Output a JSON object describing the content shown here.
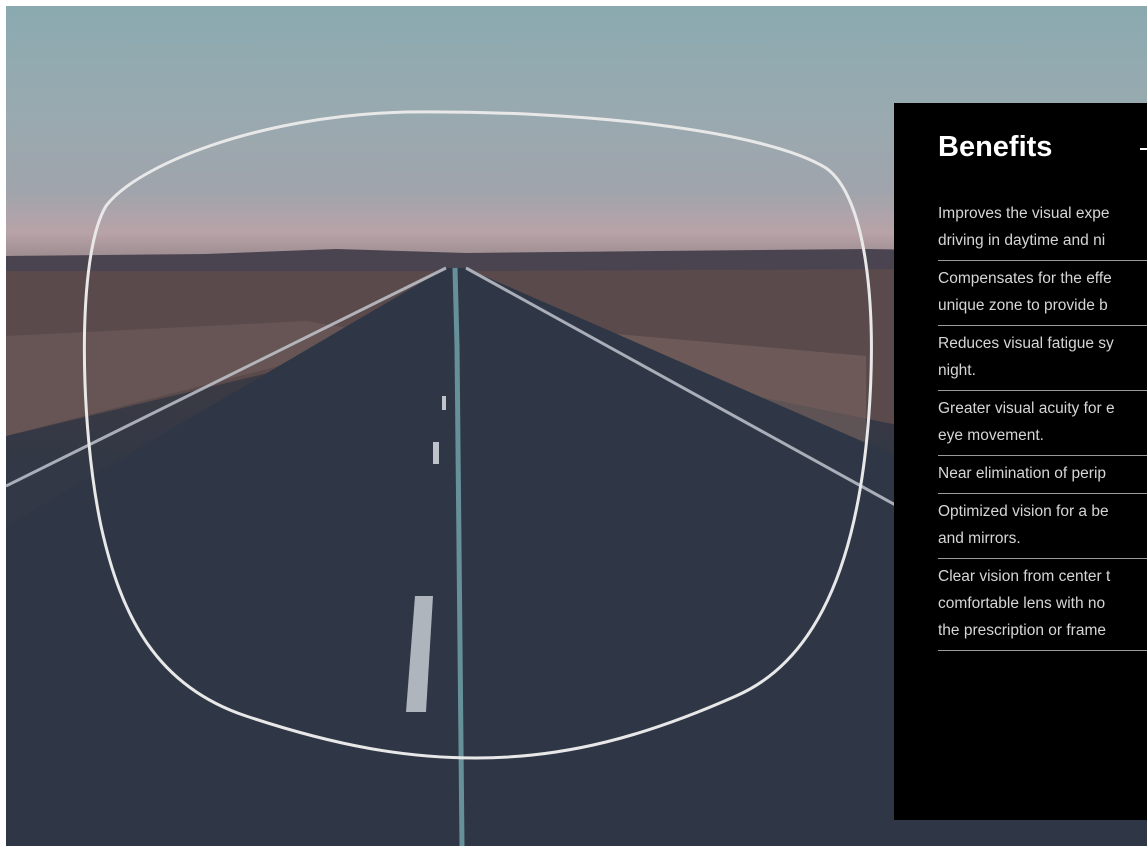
{
  "panel": {
    "title": "Benefits",
    "items": [
      "Improves the visual expe\ndriving in daytime and ni",
      "Compensates for the effe\nunique zone to provide b",
      "Reduces visual fatigue sy\nnight.",
      "Greater visual acuity for e\neye movement.",
      "Near elimination of perip",
      "Optimized vision for a be\nand mirrors.",
      "Clear vision from center t\ncomfortable lens with no\nthe prescription or frame"
    ]
  },
  "image": {
    "subject": "road-through-lens-image",
    "colors": {
      "sky": "#8aaab0",
      "horizon": "#b8a3a8",
      "road": "#2f3746",
      "lens_outline": "#e8e8e8"
    }
  }
}
